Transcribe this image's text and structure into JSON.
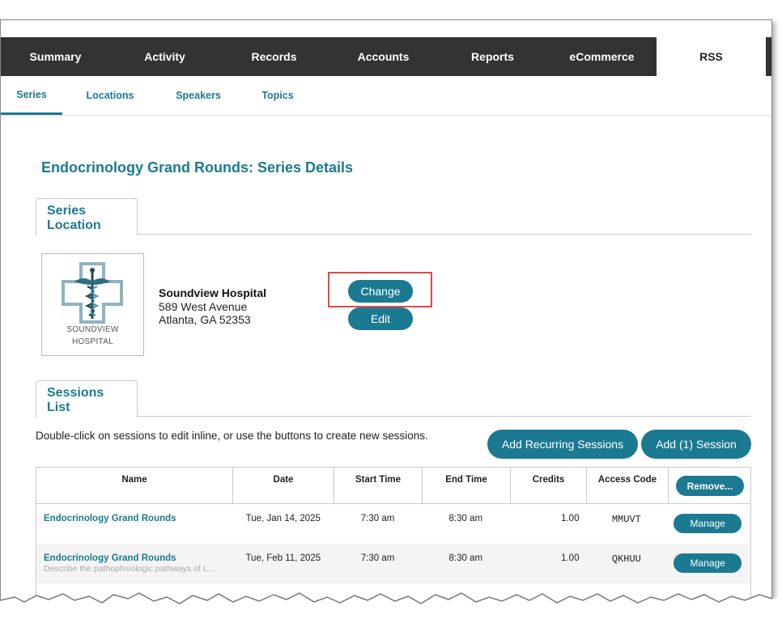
{
  "topnav": {
    "tabs": [
      {
        "label": "Summary"
      },
      {
        "label": "Activity"
      },
      {
        "label": "Records"
      },
      {
        "label": "Accounts"
      },
      {
        "label": "Reports"
      },
      {
        "label": "eCommerce"
      },
      {
        "label": "RSS"
      }
    ],
    "active": "RSS"
  },
  "subnav": {
    "tabs": [
      {
        "label": "Series"
      },
      {
        "label": "Locations"
      },
      {
        "label": "Speakers"
      },
      {
        "label": "Topics"
      }
    ],
    "active": "Series"
  },
  "page": {
    "title": "Endocrinology Grand Rounds: Series Details"
  },
  "series_location": {
    "tab_line1": "Series",
    "tab_line2": "Location",
    "logo_line1": "SOUNDVIEW",
    "logo_line2": "HOSPITAL",
    "name": "Soundview Hospital",
    "address1": "589 West Avenue",
    "address2": "Atlanta, GA 52353",
    "change_label": "Change",
    "edit_label": "Edit"
  },
  "sessions": {
    "tab_line1": "Sessions",
    "tab_line2": "List",
    "hint": "Double-click on sessions to edit inline, or use the buttons to create new sessions.",
    "add_recurring_label": "Add Recurring Sessions",
    "add_one_label": "Add (1) Session",
    "columns": {
      "name": "Name",
      "date": "Date",
      "start": "Start Time",
      "end": "End Time",
      "credits": "Credits",
      "access": "Access Code",
      "remove": "Remove..."
    },
    "rows": [
      {
        "name": "Endocrinology Grand Rounds",
        "desc": "",
        "date": "Tue, Jan 14, 2025",
        "start": "7:30 am",
        "end": "8:30 am",
        "credits": "1.00",
        "access": "MMUVT",
        "manage": "Manage"
      },
      {
        "name": "Endocrinology Grand Rounds",
        "desc": "Describe the pathophsiologic pathways of L...",
        "date": "Tue, Feb 11, 2025",
        "start": "7:30 am",
        "end": "8:30 am",
        "credits": "1.00",
        "access": "QKHUU",
        "manage": "Manage"
      }
    ]
  },
  "colors": {
    "accent": "#1b7a92",
    "nav_bg": "#333333",
    "highlight": "#e04848"
  }
}
